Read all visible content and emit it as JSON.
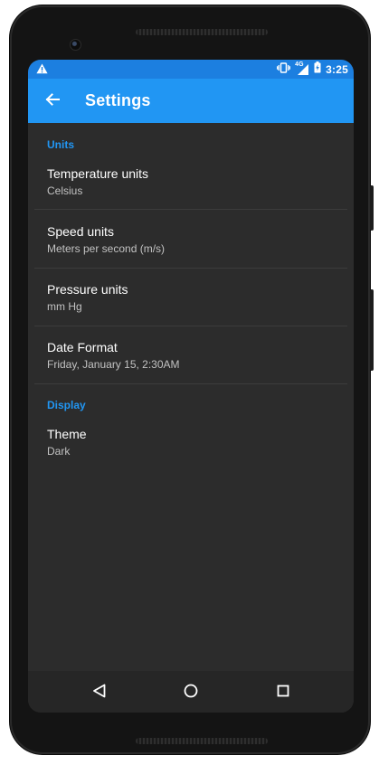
{
  "status_bar": {
    "time": "3:25",
    "network": "4G",
    "icons": [
      "warning-icon",
      "vibrate-icon",
      "cellular-signal-icon",
      "battery-charging-icon"
    ]
  },
  "toolbar": {
    "title": "Settings",
    "back_icon": "arrow-back-icon",
    "background": "#2196f3"
  },
  "sections": [
    {
      "header": "Units",
      "items": [
        {
          "title": "Temperature units",
          "summary": "Celsius"
        },
        {
          "title": "Speed units",
          "summary": "Meters per second (m/s)"
        },
        {
          "title": "Pressure units",
          "summary": "mm Hg"
        },
        {
          "title": "Date Format",
          "summary": "Friday, January 15, 2:30AM"
        }
      ]
    },
    {
      "header": "Display",
      "items": [
        {
          "title": "Theme",
          "summary": "Dark"
        }
      ]
    }
  ],
  "navigation_bar": {
    "icons": [
      "back-triangle-icon",
      "home-circle-icon",
      "recents-square-icon"
    ]
  },
  "colors": {
    "accent": "#2196f3",
    "status_bar": "#1c7fe0",
    "background": "#2c2c2c"
  }
}
